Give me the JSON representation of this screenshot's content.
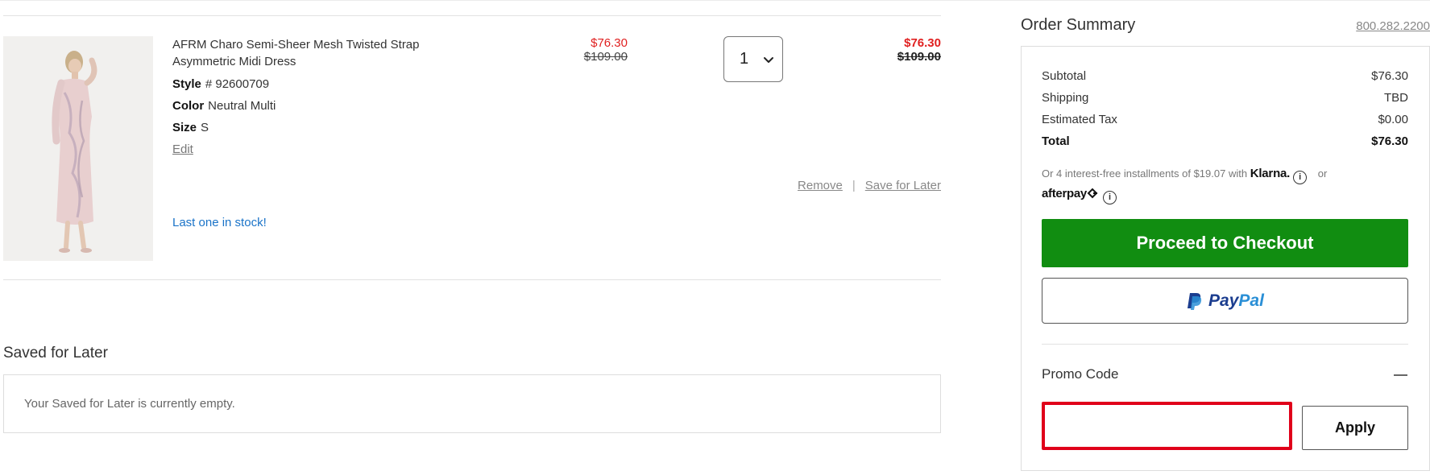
{
  "cart_item": {
    "title": "AFRM Charo Semi-Sheer Mesh Twisted Strap Asymmetric Midi Dress",
    "style_label": "Style",
    "style_value": "# 92600709",
    "color_label": "Color",
    "color_value": "Neutral Multi",
    "size_label": "Size",
    "size_value": "S",
    "edit_label": "Edit",
    "unit_price_sale": "$76.30",
    "unit_price_original": "$109.00",
    "quantity": "1",
    "total_price_sale": "$76.30",
    "total_price_original": "$109.00",
    "remove_label": "Remove",
    "separator": "|",
    "save_for_later_label": "Save for Later",
    "stock_message": "Last one in stock!"
  },
  "saved_for_later": {
    "title": "Saved for Later",
    "empty_message": "Your Saved for Later is currently empty."
  },
  "order_summary": {
    "title": "Order Summary",
    "phone": "800.282.2200",
    "lines": [
      {
        "label": "Subtotal",
        "value": "$76.30"
      },
      {
        "label": "Shipping",
        "value": "TBD"
      },
      {
        "label": "Estimated Tax",
        "value": "$0.00"
      },
      {
        "label": "Total",
        "value": "$76.30"
      }
    ],
    "installments_text": "Or 4 interest-free installments of $19.07 with",
    "klarna_label": "Klarna.",
    "or_label": "or",
    "afterpay_label": "afterpay",
    "info_glyph": "i",
    "checkout_label": "Proceed to Checkout",
    "paypal_pay": "Pay",
    "paypal_pal": "Pal",
    "promo_title": "Promo Code",
    "promo_placeholder": "",
    "apply_label": "Apply"
  },
  "colors": {
    "sale_red": "#e02020",
    "checkout_green": "#118d11",
    "stock_blue": "#1a73c8",
    "promo_highlight": "#e0001a",
    "paypal_dark": "#1b3d8f",
    "paypal_light": "#2a8fd6"
  },
  "icons": {
    "quantity_chevron": "chevron-down-icon",
    "promo_toggle": "minus-icon",
    "info": "info-icon"
  }
}
